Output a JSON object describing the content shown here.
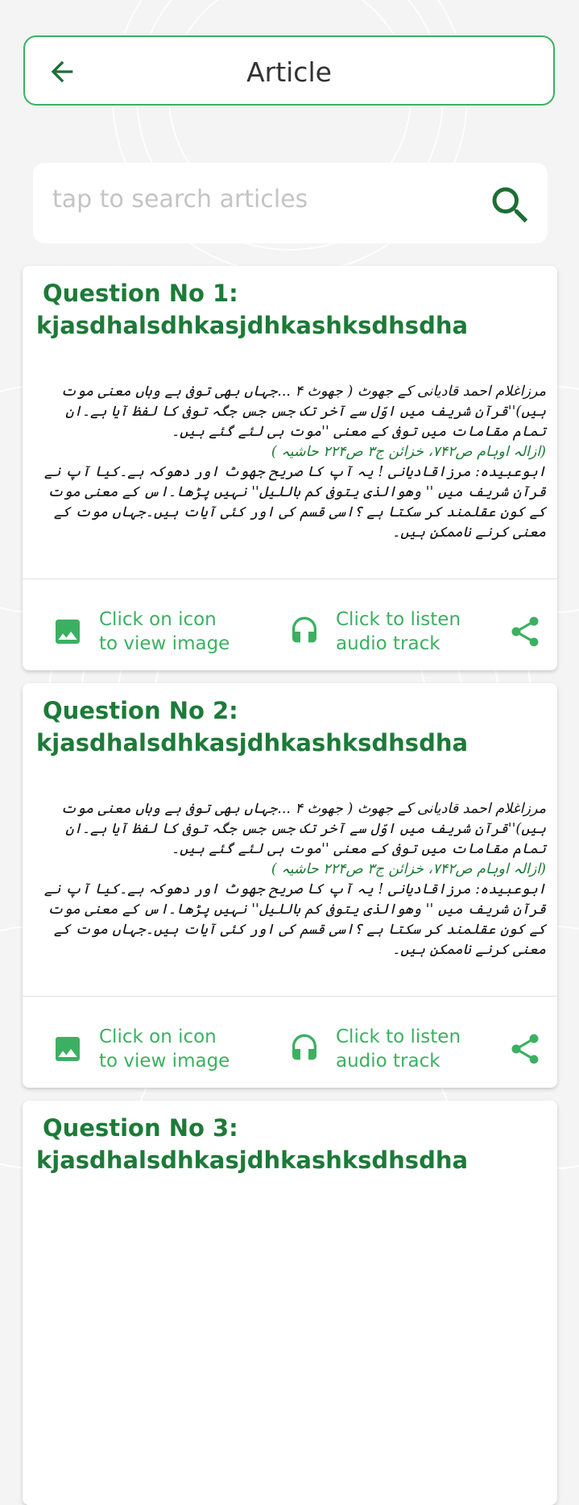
{
  "header": {
    "title": "Article",
    "back_icon": "arrow-left-icon"
  },
  "search": {
    "placeholder": "tap to search articles",
    "value": "",
    "icon": "search-icon"
  },
  "colors": {
    "accent": "#3cb062",
    "title_green": "#1d7a38"
  },
  "articles": [
    {
      "question": "Question No 1:",
      "subject": "kjasdhalsdhkasjdhkashksdhsdha",
      "body": {
        "para1": "مرزاغلام احمد قادیانی کے جھوٹ ( جھوٹ ۴ ...جہاں بھی توفی ہے وہاں معنی موت ہیں)''قرآن شریف میں اوّل سے آخر تک جس جس جگہ توفی کا لفظ آیا ہے۔ان تمام مقامات میں توفی کے معنی ''موت ہی لئے گئے ہیں۔",
        "reference": "(ازالہ اوہام ص۷۴۲، خزائن ج۳ ص۲۲۴ حاشیہ )",
        "para2": "ابوعبیدہ: مرزاقادیانی ! یہ آپ کا صریح جھوٹ اور دھوکہ ہے۔کیا آپ نے قرآن شریف میں '' وھوالذی یتوفی کم باللیل'' نہیں پڑھا۔اس کے معنی موت کے کون عقلمند کر سکتا ہے ؟اسی قسم کی اور کئی آیات ہیں۔جہاں موت کے معنی کرنے ناممکن ہیں۔"
      },
      "image_action": {
        "line1": "Click on icon",
        "line2": "to view image",
        "icon": "image-icon"
      },
      "audio_action": {
        "line1": "Click to listen",
        "line2": "audio track",
        "icon": "headphones-icon"
      },
      "share_icon": "share-icon"
    },
    {
      "question": "Question No 2:",
      "subject": "kjasdhalsdhkasjdhkashksdhsdha",
      "body": {
        "para1": "مرزاغلام احمد قادیانی کے جھوٹ ( جھوٹ ۴ ...جہاں بھی توفی ہے وہاں معنی موت ہیں)''قرآن شریف میں اوّل سے آخر تک جس جس جگہ توفی کا لفظ آیا ہے۔ان تمام مقامات میں توفی کے معنی ''موت ہی لئے گئے ہیں۔",
        "reference": "(ازالہ اوہام ص۷۴۲، خزائن ج۳ ص۲۲۴ حاشیہ )",
        "para2": "ابوعبیدہ: مرزاقادیانی ! یہ آپ کا صریح جھوٹ اور دھوکہ ہے۔کیا آپ نے قرآن شریف میں '' وھوالذی یتوفی کم باللیل'' نہیں پڑھا۔اس کے معنی موت کے کون عقلمند کر سکتا ہے ؟اسی قسم کی اور کئی آیات ہیں۔جہاں موت کے معنی کرنے ناممکن ہیں۔"
      },
      "image_action": {
        "line1": "Click on icon",
        "line2": "to view image",
        "icon": "image-icon"
      },
      "audio_action": {
        "line1": "Click to listen",
        "line2": "audio track",
        "icon": "headphones-icon"
      },
      "share_icon": "share-icon"
    },
    {
      "question": "Question No 3:",
      "subject": "kjasdhalsdhkasjdhkashksdhsdha"
    }
  ]
}
